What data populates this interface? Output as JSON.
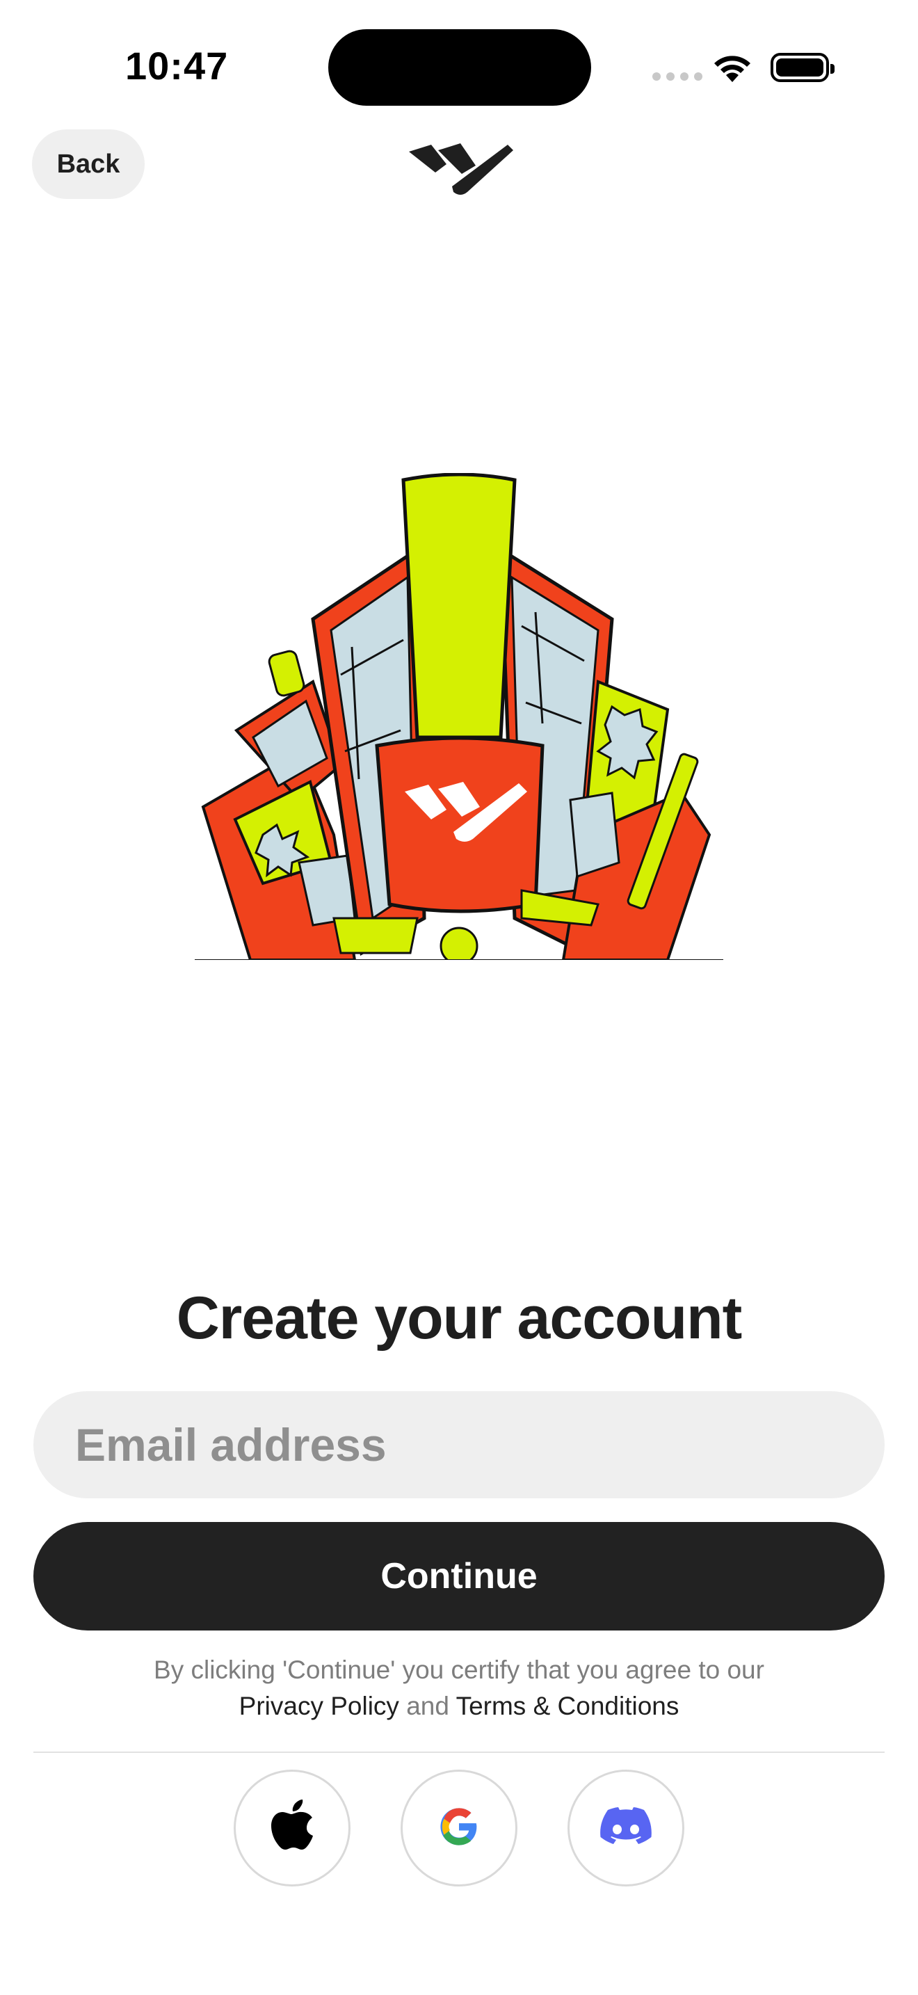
{
  "status_bar": {
    "time": "10:47"
  },
  "header": {
    "back_label": "Back",
    "logo_icon": "brand-logo-icon"
  },
  "hero": {
    "illustration": "city-buildings-illustration"
  },
  "form": {
    "title": "Create your account",
    "email_placeholder": "Email address",
    "email_value": "",
    "continue_label": "Continue"
  },
  "legal": {
    "line1": "By clicking 'Continue' you certify that you agree to our",
    "privacy_label": "Privacy Policy",
    "and_text": "and",
    "terms_label": "Terms & Conditions"
  },
  "social_login": [
    {
      "icon": "apple-icon"
    },
    {
      "icon": "google-icon"
    },
    {
      "icon": "discord-icon"
    }
  ],
  "colors": {
    "primary_dark": "#222222",
    "field_bg": "#efefef",
    "brand_orange": "#f0421c",
    "brand_lime": "#d4f002",
    "discord_blurple": "#5865F2"
  }
}
